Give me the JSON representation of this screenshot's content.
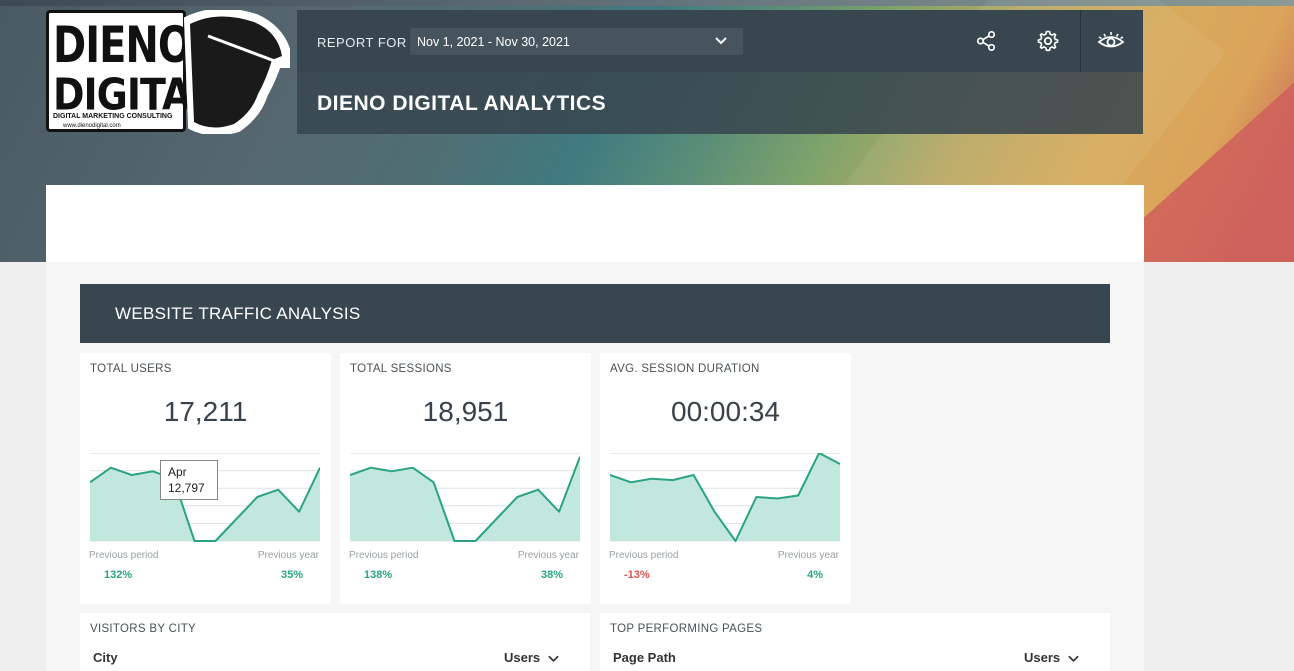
{
  "header": {
    "report_for_label": "REPORT FOR",
    "date_range": "Nov 1, 2021 - Nov 30, 2021",
    "title": "DIENO DIGITAL ANALYTICS",
    "icons": [
      "share-icon",
      "gear-icon",
      "eye-icon"
    ]
  },
  "logo": {
    "line1": "DIENO",
    "line2": "DIGITAL",
    "tagline": "DIGITAL MARKETING CONSULTING",
    "url": "www.dienodigital.com"
  },
  "section": {
    "title": "WEBSITE TRAFFIC ANALYSIS"
  },
  "kpis": [
    {
      "label": "TOTAL USERS",
      "value": "17,211",
      "prev_period_label": "Previous period",
      "prev_period_value": "132%",
      "prev_year_label": "Previous year",
      "prev_year_value": "35%",
      "tooltip": {
        "month": "Apr",
        "value": "12,797"
      }
    },
    {
      "label": "TOTAL SESSIONS",
      "value": "18,951",
      "prev_period_label": "Previous period",
      "prev_period_value": "138%",
      "prev_year_label": "Previous year",
      "prev_year_value": "38%"
    },
    {
      "label": "AVG. SESSION DURATION",
      "value": "00:00:34",
      "prev_period_label": "Previous period",
      "prev_period_value": "-13%",
      "prev_year_label": "Previous year",
      "prev_year_value": "4%"
    }
  ],
  "tables": [
    {
      "label": "VISITORS BY CITY",
      "col_a": "City",
      "col_b": "Users"
    },
    {
      "label": "TOP PERFORMING PAGES",
      "col_a": "Page Path",
      "col_b": "Users"
    }
  ],
  "chart_data": [
    {
      "type": "area",
      "series": [
        {
          "values": [
            14,
            16,
            15,
            15.5,
            14.5,
            6,
            6,
            9,
            12,
            13,
            10,
            16
          ]
        }
      ],
      "ylim": [
        6,
        18
      ]
    },
    {
      "type": "area",
      "series": [
        {
          "values": [
            15,
            16,
            15.5,
            16,
            14,
            6,
            6,
            9,
            12,
            13,
            10,
            17.5
          ]
        }
      ],
      "ylim": [
        6,
        18
      ]
    },
    {
      "type": "area",
      "series": [
        {
          "values": [
            35,
            34,
            34.5,
            34.3,
            35,
            30,
            26,
            32,
            31.8,
            32.2,
            38,
            36.5
          ]
        }
      ],
      "ylim": [
        26,
        38
      ]
    }
  ],
  "colors": {
    "accent": "#2aa383",
    "area_fill": "#bfe7dc",
    "dark_panel": "#38474f",
    "negative": "#d9534f"
  }
}
